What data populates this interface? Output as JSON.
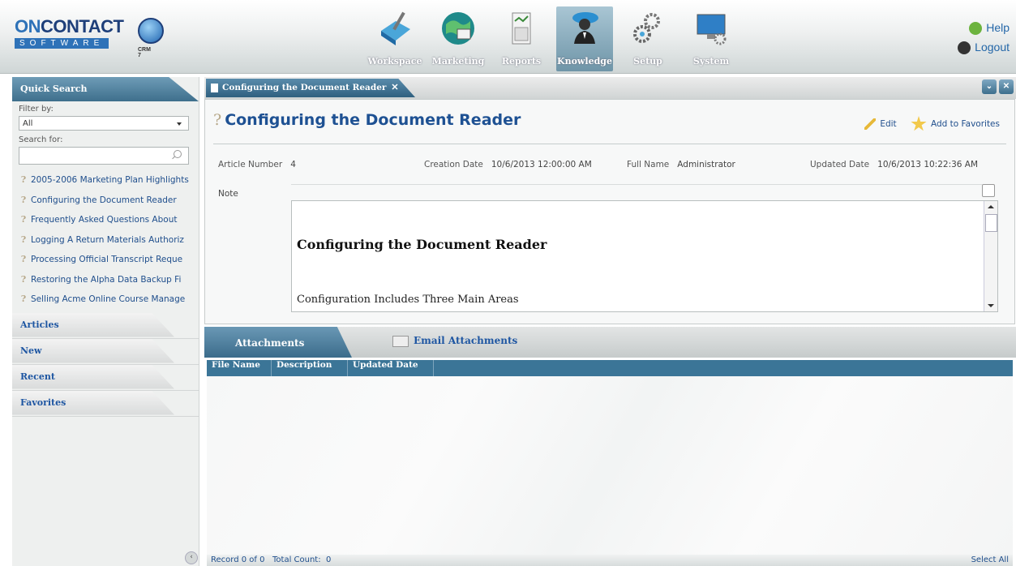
{
  "brand": {
    "name_part1": "ON",
    "name_part2": "CONTACT",
    "tagline": "SOFTWARE",
    "edition": "CRM 7"
  },
  "nav": {
    "items": [
      {
        "label": "Workspace",
        "icon": "workspace-icon",
        "active": false
      },
      {
        "label": "Marketing",
        "icon": "globe-icon",
        "active": false
      },
      {
        "label": "Reports",
        "icon": "report-icon",
        "active": false
      },
      {
        "label": "Knowledge",
        "icon": "knowledge-person-icon",
        "active": true
      },
      {
        "label": "Setup",
        "icon": "gears-icon",
        "active": false
      },
      {
        "label": "System",
        "icon": "monitor-icon",
        "active": false
      }
    ]
  },
  "header_links": {
    "help": "Help",
    "logout": "Logout"
  },
  "sidebar": {
    "quick_search_title": "Quick Search",
    "filter_label": "Filter by:",
    "filter_value": "All",
    "search_label": "Search for:",
    "search_value": "",
    "results": [
      "2005-2006 Marketing Plan Highlights",
      "Configuring the Document Reader",
      "Frequently Asked Questions About",
      "Logging A Return Materials Authoriz",
      "Processing Official Transcript Reque",
      "Restoring the Alpha Data Backup Fi",
      "Selling Acme Online Course Manage"
    ],
    "sections": [
      "Articles",
      "New",
      "Recent",
      "Favorites"
    ]
  },
  "doc_tab": {
    "label": "Configuring the Document Reader"
  },
  "article": {
    "title": "Configuring the Document Reader",
    "actions": {
      "edit": "Edit",
      "favorite": "Add to Favorites"
    },
    "meta": {
      "article_number_label": "Article Number",
      "article_number": "4",
      "creation_date_label": "Creation Date",
      "creation_date": "10/6/2013 12:00:00 AM",
      "full_name_label": "Full Name",
      "full_name": "Administrator",
      "updated_date_label": "Updated Date",
      "updated_date": "10/6/2013 10:22:36 AM"
    },
    "note_label": "Note",
    "note_heading": "Configuring the Document Reader",
    "note_text": "Configuration Includes Three Main Areas"
  },
  "attachments": {
    "tab_label": "Attachments",
    "email_tab_label": "Email Attachments",
    "columns": [
      "File Name",
      "Description",
      "Updated Date"
    ],
    "rows": []
  },
  "status": {
    "record": "Record 0 of 0",
    "total_label": "Total Count:",
    "total": "0",
    "select_all": "Select All"
  },
  "colors": {
    "accent": "#3b7597",
    "link": "#1f4e8c",
    "title": "#1e5193"
  }
}
